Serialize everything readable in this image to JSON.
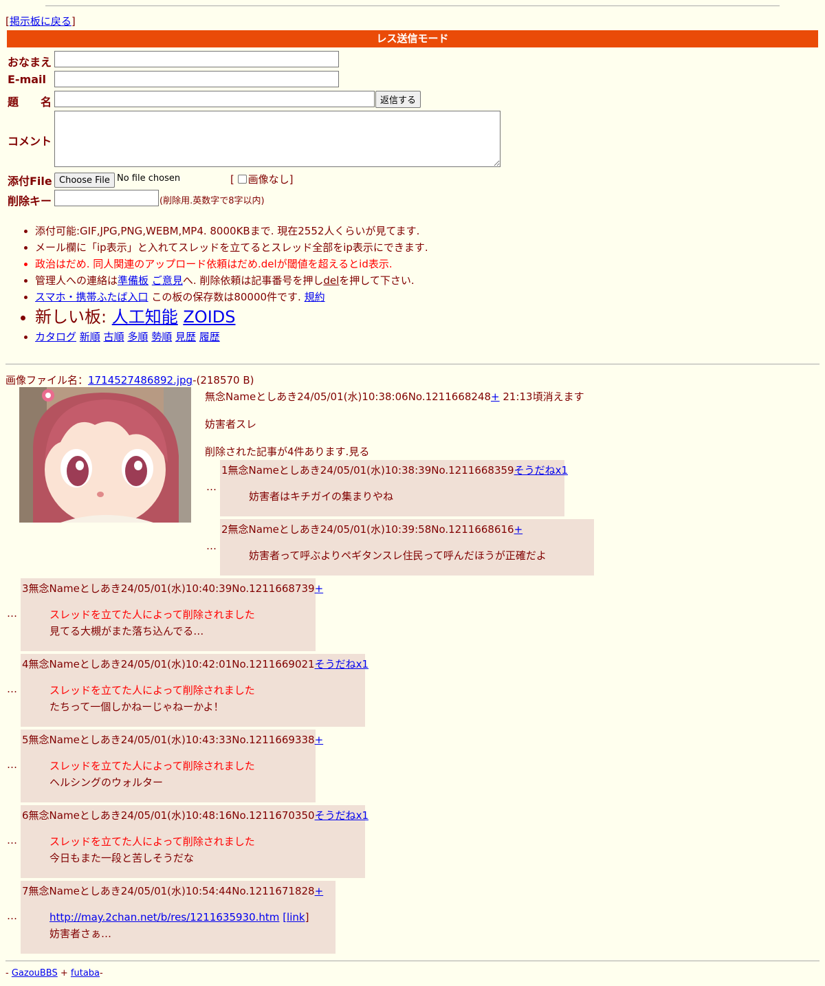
{
  "nav": {
    "back_open": "[",
    "back_label": "掲示板に戻る",
    "back_close": "]"
  },
  "mode_bar": {
    "label": "レス送信モード",
    "color": "#ea4b08"
  },
  "form": {
    "name_label": "おなまえ",
    "email_label": "E-mail",
    "subject_label": "題　　名",
    "submit_label": "返信する",
    "comment_label": "コメント",
    "file_label": "添付File",
    "file_button": "Choose File",
    "file_status": "No file chosen",
    "no_image_open": "[",
    "no_image_label": "画像なし",
    "no_image_close": "]",
    "delkey_label": "削除キー",
    "delkey_note": "(削除用.英数字で8字以内)"
  },
  "rules": {
    "r1": "添付可能:GIF,JPG,PNG,WEBM,MP4. 8000KBまで. 現在2552人くらいが見てます.",
    "r2": "メール欄に「ip表示」と入れてスレッドを立てるとスレッド全部をip表示にできます.",
    "r3": "政治はだめ. 同人関連のアップロード依頼はだめ.delが閾値を超えるとid表示.",
    "r4_a": "管理人への連絡は",
    "r4_link1": "準備板",
    "r4_link2": "ご意見",
    "r4_b": "へ. 削除依頼は記事番号を押し",
    "r4_link3": "del",
    "r4_c": "を押して下さい.",
    "r5_link": "スマホ・携帯ふたば入口",
    "r5_text": " この板の保存数は80000件です. ",
    "r5_link2": "規約",
    "r6_text": "新しい板: ",
    "r6_link1": "人工知能",
    "r6_link2": "ZOIDS",
    "r7_links": [
      "カタログ",
      "新順",
      "古順",
      "多順",
      "勢順",
      "見歴",
      "履歴"
    ]
  },
  "thread": {
    "file_label": "画像ファイル名：",
    "file_name": "1714527486892.jpg",
    "file_size": "-(218570 B)",
    "header": "無念Nameとしあき24/05/01(水)10:38:06No.1211668248",
    "plus": "+",
    "expire": " 21:13頃消えます",
    "body": "妨害者スレ",
    "deleted_note": "削除された記事が4件あります.見る"
  },
  "dots": "…",
  "replies": [
    {
      "head": "1無念Nameとしあき24/05/01(水)10:38:39No.1211668359",
      "link": "そうだねx1",
      "deleted": "",
      "body": "妨害者はキチガイの集まりやね"
    },
    {
      "head": "2無念Nameとしあき24/05/01(水)10:39:58No.1211668616",
      "link": "+",
      "deleted": "",
      "body": "妨害者って呼ぶよりペギタンスレ住民って呼んだほうが正確だよ"
    },
    {
      "head": "3無念Nameとしあき24/05/01(水)10:40:39No.1211668739",
      "link": "+",
      "deleted": "スレッドを立てた人によって削除されました",
      "body": "見てる大槻がまた落ち込んでる…"
    },
    {
      "head": "4無念Nameとしあき24/05/01(水)10:42:01No.1211669021",
      "link": "そうだねx1",
      "deleted": "スレッドを立てた人によって削除されました",
      "body": "たちって一個しかねーじゃねーかよ！"
    },
    {
      "head": "5無念Nameとしあき24/05/01(水)10:43:33No.1211669338",
      "link": "+",
      "deleted": "スレッドを立てた人によって削除されました",
      "body": "ヘルシングのウォルター"
    },
    {
      "head": "6無念Nameとしあき24/05/01(水)10:48:16No.1211670350",
      "link": "そうだねx1",
      "deleted": "スレッドを立てた人によって削除されました",
      "body": "今日もまた一段と苦しそうだな"
    },
    {
      "head": "7無念Nameとしあき24/05/01(水)10:54:44No.1211671828",
      "link": "+",
      "url": "http://may.2chan.net/b/res/1211635930.htm",
      "url_tag": "[link",
      "url_close": "]",
      "body": "妨害者さぁ…"
    }
  ],
  "footer": {
    "dash1": "- ",
    "link1": "GazouBBS",
    "plus": " + ",
    "link2": "futaba",
    "dash2": "-"
  }
}
